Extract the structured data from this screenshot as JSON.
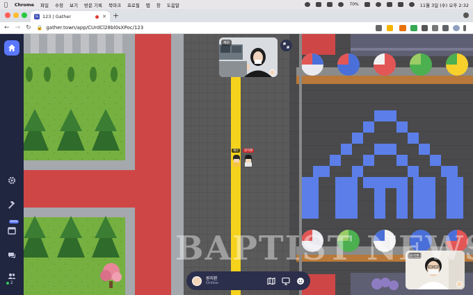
{
  "menubar": {
    "app": "Chrome",
    "items": [
      "파일",
      "수정",
      "보기",
      "방문 기록",
      "북마크",
      "프로필",
      "탭",
      "창",
      "도움말"
    ],
    "battery": "70%",
    "datetime": "11월 3일 (수) 오후 2:32"
  },
  "tab": {
    "title": "123 | Gather"
  },
  "address": {
    "url": "gather.town/app/CUrdCl28bl0sXPoc/123"
  },
  "sidebar": {
    "beta_label": "beta",
    "participants": "2"
  },
  "video_top": {
    "name": "재은"
  },
  "video_bottom": {
    "name": "원지환"
  },
  "avatars": [
    {
      "name": "재은"
    },
    {
      "name": "원지환"
    }
  ],
  "watermark": "BAPTIST NEWS",
  "bottombar": {
    "name": "원지환",
    "status": "Online"
  },
  "colors": {
    "sidebar": "#202540",
    "accent": "#5a77ff",
    "road": "#5c5c5c",
    "red_path": "#cf4646",
    "yellow_line": "#f5d21c",
    "grass": "#7cb342",
    "sign_blue": "#5b7ee8"
  },
  "icons": [
    "home-icon",
    "gear-icon",
    "hammer-icon",
    "calendar-icon",
    "chat-icon",
    "people-icon",
    "map-icon",
    "screen-share-icon",
    "emoji-icon",
    "expand-icon"
  ]
}
